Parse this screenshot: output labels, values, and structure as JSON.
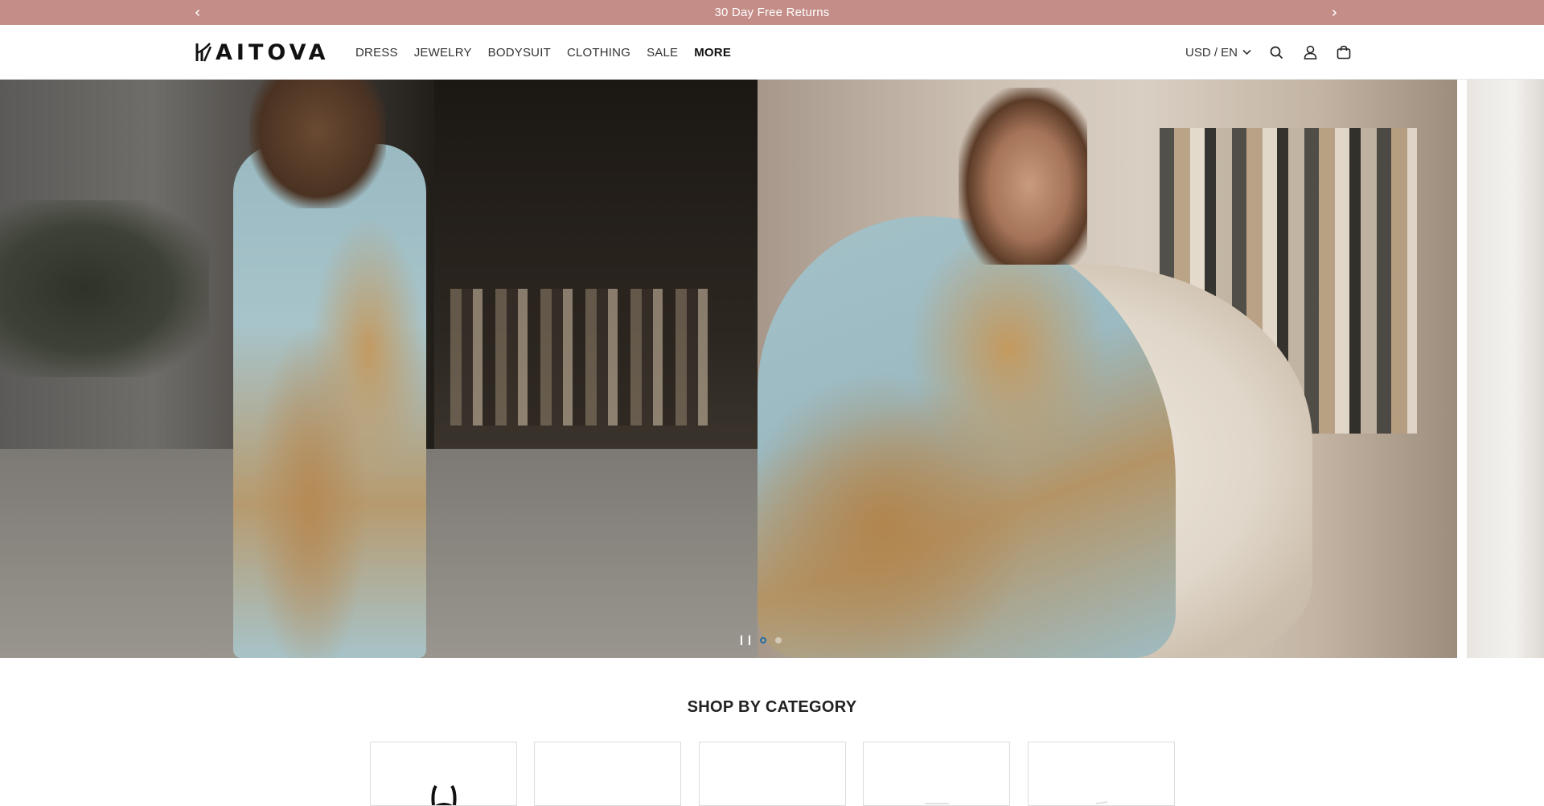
{
  "announcement": {
    "message": "30 Day Free Returns",
    "prev_icon": "chevron-left-icon",
    "next_icon": "chevron-right-icon"
  },
  "header": {
    "logo_text": "AITOVA",
    "nav": [
      {
        "label": "DRESS"
      },
      {
        "label": "JEWELRY"
      },
      {
        "label": "BODYSUIT"
      },
      {
        "label": "CLOTHING"
      },
      {
        "label": "SALE"
      },
      {
        "label": "MORE"
      }
    ],
    "currency_label": "USD / EN",
    "icons": [
      "search-icon",
      "account-icon",
      "cart-icon"
    ]
  },
  "hero": {
    "slide_count": 2,
    "active_slide": 1
  },
  "category_section": {
    "title": "SHOP BY CATEGORY",
    "card_count": 5
  },
  "colors": {
    "announcement_bg": "#c48d87",
    "active_dot": "#2a6f9f"
  }
}
